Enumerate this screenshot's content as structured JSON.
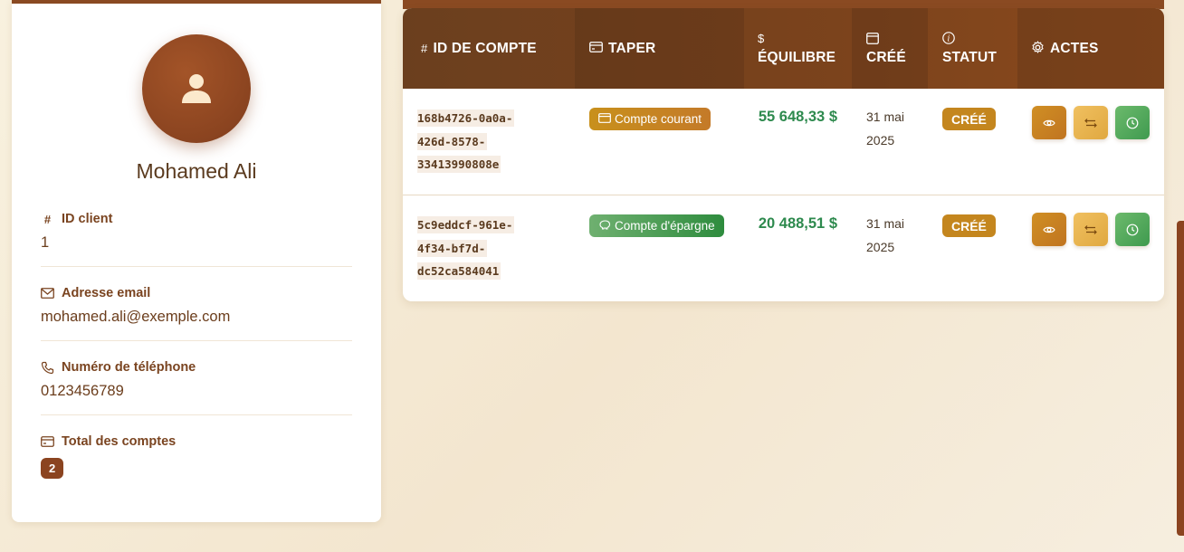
{
  "profile": {
    "name": "Mohamed Ali",
    "fields": {
      "client_id": {
        "label": "ID client",
        "value": "1",
        "icon": "hash-icon"
      },
      "email": {
        "label": "Adresse email",
        "value": "mohamed.ali@exemple.com",
        "icon": "mail-icon"
      },
      "phone": {
        "label": "Numéro de téléphone",
        "value": "0123456789",
        "icon": "phone-icon"
      },
      "total_accounts": {
        "label": "Total des comptes",
        "value": "2",
        "icon": "card-icon"
      }
    }
  },
  "table": {
    "headers": {
      "id": "ID DE COMPTE",
      "type": "TAPER",
      "balance": "ÉQUILIBRE",
      "created": "CRÉÉ",
      "status": "STATUT",
      "actions": "ACTES"
    },
    "header_icons": {
      "id": "#",
      "balance": "$"
    },
    "rows": [
      {
        "account_id": "168b4726-0a0a-426d-8578-33413990808e",
        "type": "Compte courant",
        "type_kind": "checking",
        "balance": "55 648,33 $",
        "created": "31 mai 2025",
        "status": "CRÉÉ"
      },
      {
        "account_id": "5c9eddcf-961e-4f34-bf7d-dc52ca584041",
        "type": "Compte d'épargne",
        "type_kind": "savings",
        "balance": "20 488,51 $",
        "created": "31 mai 2025",
        "status": "CRÉÉ"
      }
    ]
  },
  "colors": {
    "brand_brown": "#8b4420",
    "accent_gold": "#c4861e",
    "positive_green": "#2e8a4e"
  }
}
